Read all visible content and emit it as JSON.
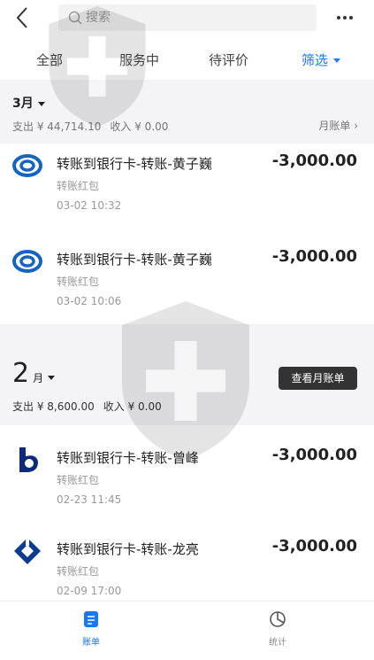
{
  "search": {
    "placeholder": "搜索"
  },
  "tabs": [
    {
      "label": "全部"
    },
    {
      "label": "服务中"
    },
    {
      "label": "待评价"
    },
    {
      "label": "筛选"
    }
  ],
  "months": [
    {
      "label": "3月",
      "expense_label": "支出",
      "expense": "¥ 44,714.10",
      "income_label": "收入",
      "income": "¥ 0.00",
      "bill_link": "月账单",
      "items": [
        {
          "title": "转账到银行卡-转账-黄子巍",
          "amount": "-3,000.00",
          "category": "转账红包",
          "time": "03-02  10:32"
        },
        {
          "title": "转账到银行卡-转账-黄子巍",
          "amount": "-3,000.00",
          "category": "转账红包",
          "time": "03-02 10:06"
        }
      ]
    },
    {
      "num": "2",
      "unit": "月",
      "expense_label": "支出",
      "expense": "¥ 8,600.00",
      "income_label": "收入",
      "income": "¥ 0.00",
      "button": "查看月账单",
      "items": [
        {
          "title": "转账到银行卡-转账-曾峰",
          "amount": "-3,000.00",
          "category": "转账红包",
          "time": "02-23  11:45"
        },
        {
          "title": "转账到银行卡-转账-龙亮",
          "amount": "-3,000.00",
          "category": "转账红包",
          "time": "02-09  17:00"
        }
      ]
    }
  ],
  "bottom_nav": [
    {
      "label": "账单",
      "icon": "bill-icon"
    },
    {
      "label": "统计",
      "icon": "pie-chart-icon"
    }
  ],
  "colors": {
    "accent": "#1677ff",
    "divider": "#f4f4f6"
  }
}
